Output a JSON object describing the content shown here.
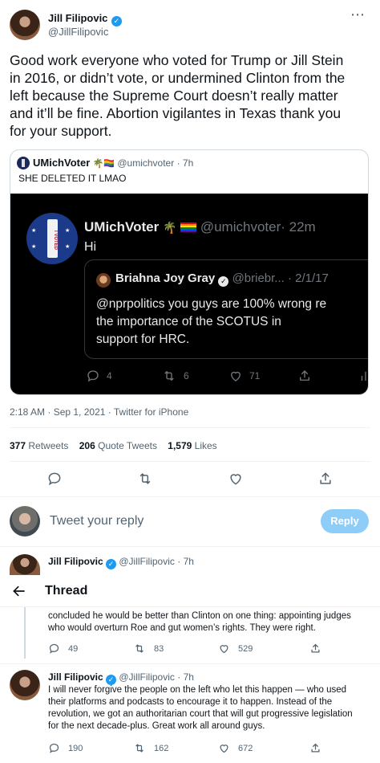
{
  "main_tweet": {
    "author_name": "Jill Filipovic",
    "author_handle": "@JillFilipovic",
    "text_lines": [
      "Good work everyone who voted for Trump or Jill Stein",
      "in 2016, or didn’t vote, or undermined Clinton from the",
      "left because the Supreme Court doesn’t really matter",
      "and it’ll be fine. Abortion vigilantes in Texas thank you",
      "for your support."
    ],
    "timestamp": "2:18 AM · Sep 1, 2021 · Twitter for iPhone",
    "retweets_count": "377",
    "retweets_label": "Retweets",
    "quotes_count": "206",
    "quotes_label": "Quote Tweets",
    "likes_count": "1,579",
    "likes_label": "Likes"
  },
  "quoted_tweet": {
    "author_name": "UMichVoter",
    "emoji": "🌴🏳️‍🌈",
    "author_handle": "@umichvoter",
    "time": "· 7h",
    "text": "SHE DELETED IT LMAO",
    "image": {
      "author_name": "UMichVoter",
      "author_handle": "@umichvoter",
      "time": "· 22m",
      "text": "Hi",
      "badge_text": "I VOTED",
      "inner_quote": {
        "author_name": "Briahna Joy Gray",
        "author_handle": "@briebr...",
        "time": "· 2/1/17",
        "text_lines": [
          "@nprpolitics you guys are 100% wrong re",
          "the importance of the SCOTUS in",
          "support for HRC."
        ]
      },
      "reply_count": "4",
      "retweet_count": "6",
      "like_count": "71"
    }
  },
  "reply_box": {
    "placeholder": "Tweet your reply",
    "button_label": "Reply"
  },
  "thread_header": {
    "title": "Thread",
    "peek_name": "Jill Filipovic",
    "peek_handle": "@JillFilipovic",
    "peek_time": "· 7h"
  },
  "thread_reply_1": {
    "text_lines": [
      "concluded he would be better than Clinton on one thing: appointing judges",
      "who would overturn Roe and gut women’s rights. They were right."
    ],
    "reply_count": "49",
    "retweet_count": "83",
    "like_count": "529"
  },
  "thread_reply_2": {
    "author_name": "Jill Filipovic",
    "author_handle": "@JillFilipovic",
    "time": "· 7h",
    "text_lines": [
      "I will never forgive the people on the left who let this happen — who used",
      "their platforms and podcasts to encourage it to happen. Instead of the",
      "revolution, we got an authoritarian court that will gut progressive legislation",
      "for the next decade-plus. Great work all around guys."
    ],
    "reply_count": "190",
    "retweet_count": "162",
    "like_count": "672"
  },
  "colors": {
    "accent": "#1d9bf0",
    "reply_button": "#8ecdf8",
    "muted": "#536471",
    "quote_image_bg": "#000000"
  }
}
